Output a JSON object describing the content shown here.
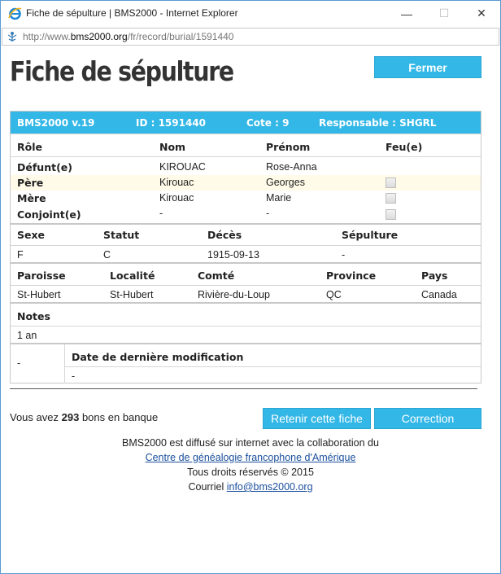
{
  "window": {
    "title": "Fiche de sépulture | BMS2000 - Internet Explorer",
    "url_prefix": "http://www.",
    "url_domain": "bms2000.org",
    "url_path": "/fr/record/burial/1591440"
  },
  "page": {
    "title": "Fiche de sépulture",
    "close_label": "Fermer"
  },
  "record_header": {
    "version": "BMS2000 v.19",
    "id": "ID : 1591440",
    "cote": "Cote : 9",
    "responsable": "Responsable : SHGRL"
  },
  "persons": {
    "headers": [
      "Rôle",
      "Nom",
      "Prénom",
      "Feu(e)"
    ],
    "rows": [
      {
        "role": "Défunt(e)",
        "nom": "KIROUAC",
        "prenom": "Rose-Anna",
        "feu": null
      },
      {
        "role": "Père",
        "nom": "Kirouac",
        "prenom": "Georges",
        "feu": false
      },
      {
        "role": "Mère",
        "nom": "Kirouac",
        "prenom": "Marie",
        "feu": false
      },
      {
        "role": "Conjoint(e)",
        "nom": "-",
        "prenom": "-",
        "feu": false
      }
    ]
  },
  "vital": {
    "headers": [
      "Sexe",
      "Statut",
      "Décès",
      "Sépulture"
    ],
    "values": [
      "F",
      "C",
      "1915-09-13",
      "-"
    ]
  },
  "place": {
    "headers": [
      "Paroisse",
      "Localité",
      "Comté",
      "Province",
      "Pays"
    ],
    "values": [
      "St-Hubert",
      "St-Hubert",
      "Rivière-du-Loup",
      "QC",
      "Canada"
    ]
  },
  "notes": {
    "header": "Notes",
    "value": "1 an"
  },
  "modification": {
    "left_value": "-",
    "header": "Date de dernière modification",
    "value": "-"
  },
  "bank": {
    "prefix": "Vous avez",
    "count": "293",
    "suffix": "bons en banque"
  },
  "actions": {
    "retain_label": "Retenir cette fiche",
    "correction_label": "Correction"
  },
  "footer": {
    "line1": "BMS2000 est diffusé sur internet avec la collaboration du",
    "link1": "Centre de généalogie francophone d'Amérique",
    "line3": "Tous droits réservés © 2015",
    "courriel_label": "Courriel",
    "email": "info@bms2000.org"
  },
  "colors": {
    "accent": "#33b7e6",
    "highlight_row": "#fffbe8",
    "link": "#1a4f9c"
  },
  "icons": {
    "browser": "internet-explorer-icon",
    "page": "page-favicon-icon",
    "minimize": "minimize-icon",
    "maximize": "maximize-icon",
    "close": "close-icon"
  }
}
